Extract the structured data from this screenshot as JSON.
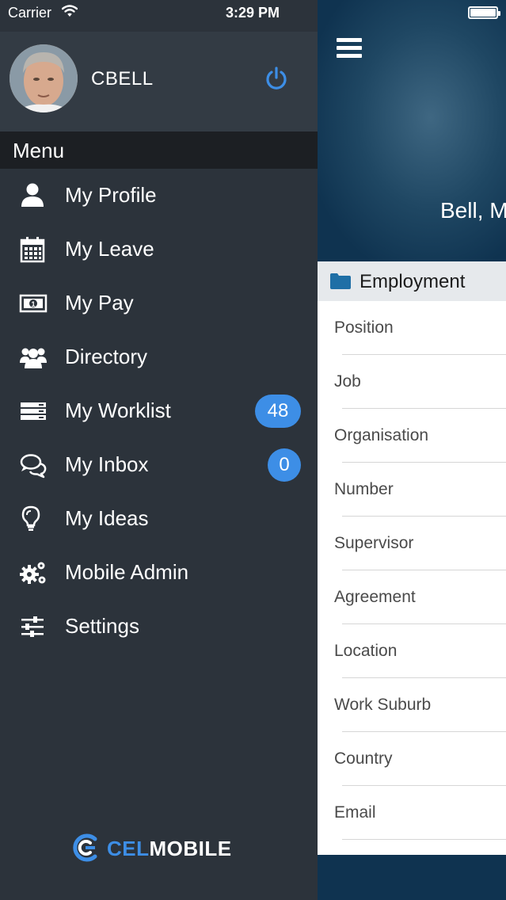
{
  "status_bar": {
    "carrier": "Carrier",
    "time": "3:29 PM"
  },
  "profile": {
    "username": "CBELL"
  },
  "menu": {
    "title": "Menu",
    "items": [
      {
        "label": "My Profile",
        "icon": "user-icon"
      },
      {
        "label": "My Leave",
        "icon": "calendar-icon"
      },
      {
        "label": "My Pay",
        "icon": "money-icon"
      },
      {
        "label": "Directory",
        "icon": "users-icon"
      },
      {
        "label": "My Worklist",
        "icon": "list-icon",
        "badge": "48"
      },
      {
        "label": "My Inbox",
        "icon": "chat-icon",
        "badge": "0"
      },
      {
        "label": "My Ideas",
        "icon": "lightbulb-icon"
      },
      {
        "label": "Mobile Admin",
        "icon": "gears-icon"
      },
      {
        "label": "Settings",
        "icon": "sliders-icon"
      }
    ]
  },
  "logo": {
    "part1": "CEL",
    "part2": "MOBILE"
  },
  "main": {
    "employee_name": "Bell, M",
    "section_title": "Employment",
    "fields": [
      "Position",
      "Job",
      "Organisation",
      "Number",
      "Supervisor",
      "Agreement",
      "Location",
      "Work Suburb",
      "Country",
      "Email"
    ]
  },
  "colors": {
    "accent": "#3d8ee6",
    "drawer_bg": "#2c333b",
    "menu_header_bg": "#1c1f23",
    "hero_bg": "#0f3350"
  }
}
